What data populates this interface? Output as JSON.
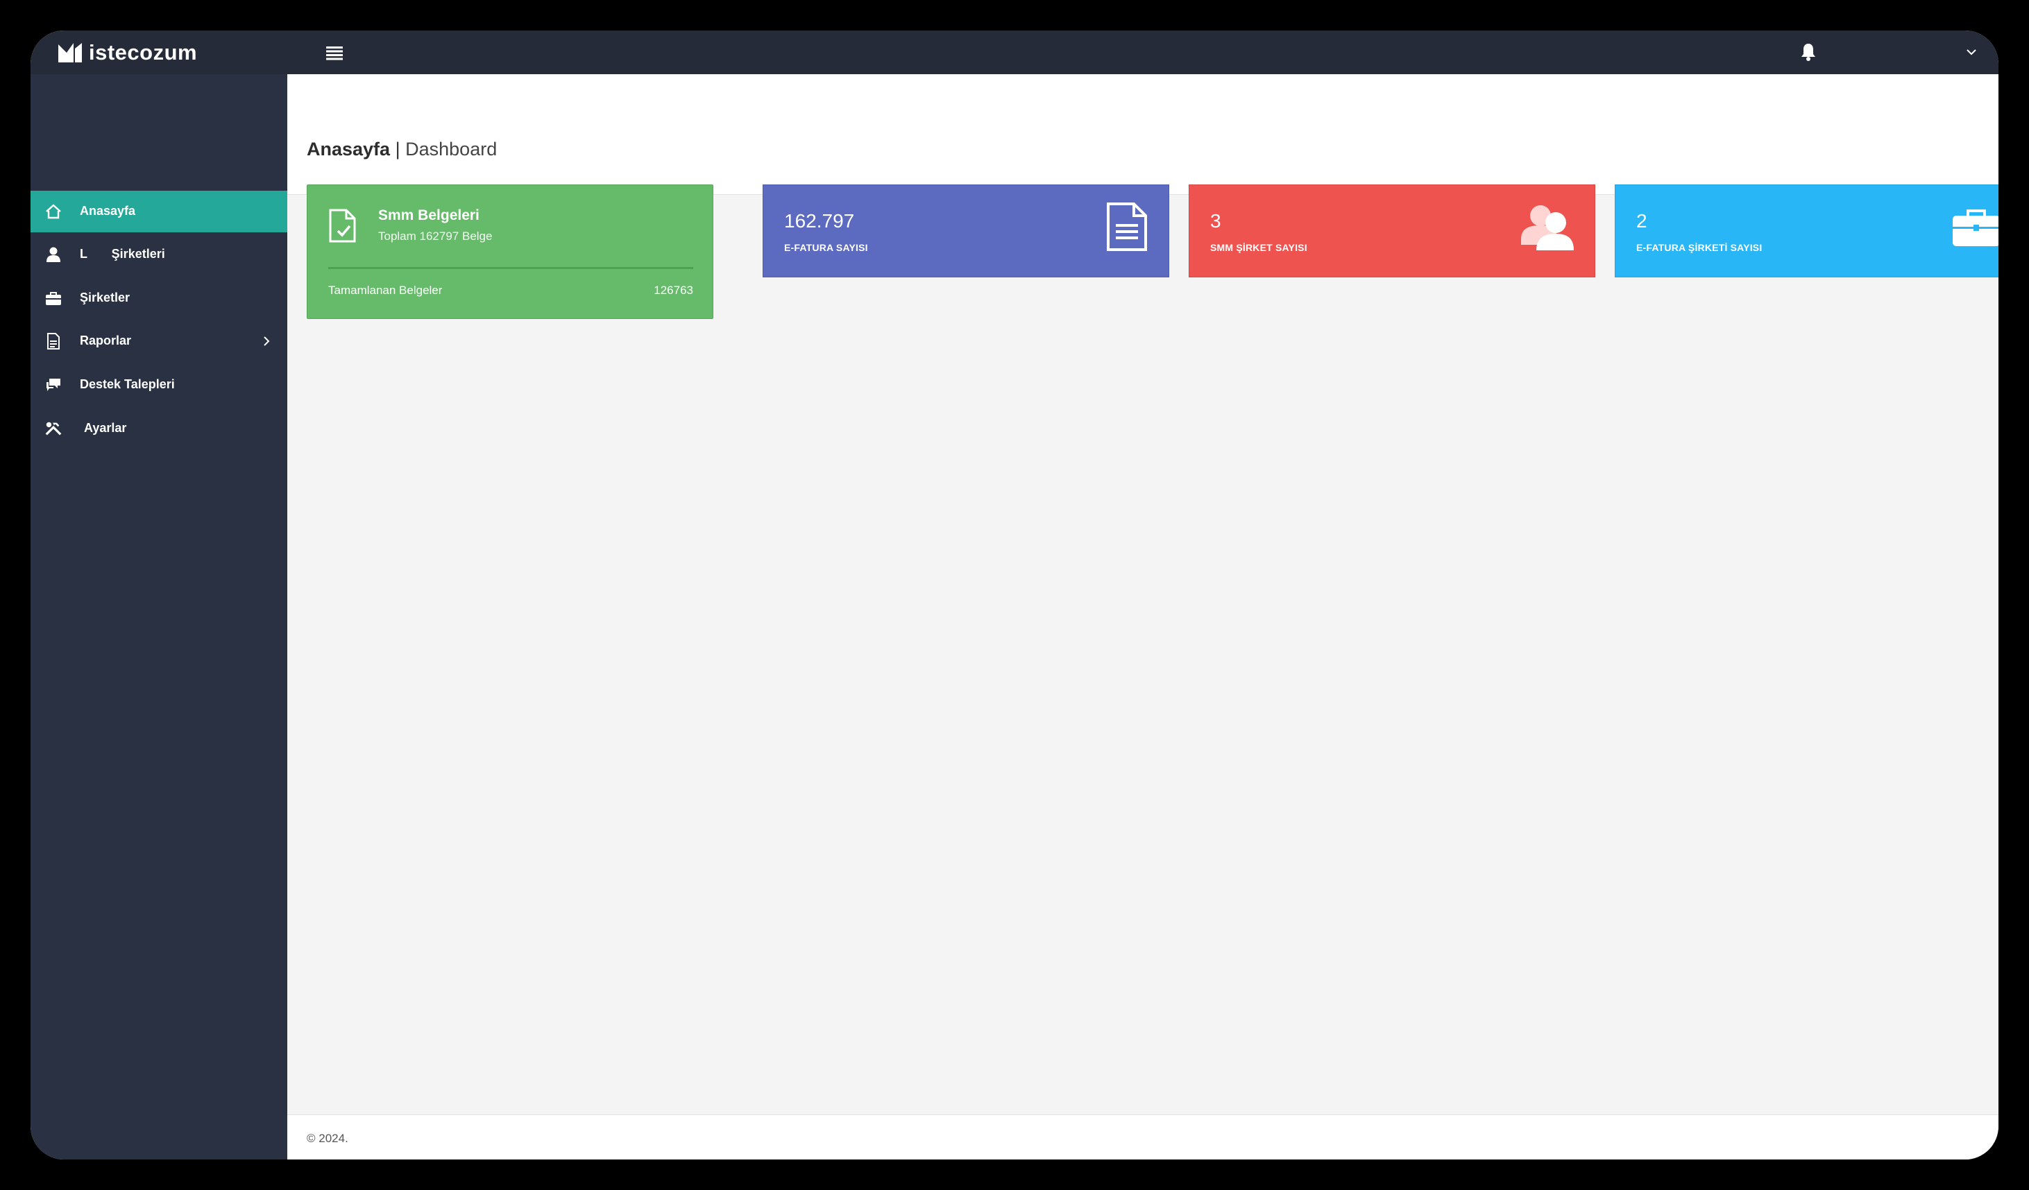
{
  "app": {
    "brand_name": "istecozum",
    "accent_color": "#23a89a"
  },
  "header": {
    "menu_icon": "hamburger-icon",
    "notification_icon": "bell-icon",
    "user_menu_icon": "chevron-down-icon"
  },
  "sidebar": {
    "items": [
      {
        "label": "Anasayfa",
        "icon": "home-icon",
        "active": true
      },
      {
        "label": "L       Şirketleri",
        "icon": "user-icon",
        "active": false
      },
      {
        "label": "Şirketler",
        "icon": "briefcase-icon",
        "active": false
      },
      {
        "label": "Raporlar",
        "icon": "report-icon",
        "active": false,
        "has_submenu": true
      },
      {
        "label": "Destek Talepleri",
        "icon": "chat-icon",
        "active": false
      },
      {
        "label": "Ayarlar",
        "icon": "tools-icon",
        "active": false
      }
    ]
  },
  "page": {
    "title": "Anasayfa",
    "separator": "|",
    "subtitle": "Dashboard"
  },
  "cards": {
    "smm": {
      "title": "Smm Belgeleri",
      "subtitle": "Toplam 162797 Belge",
      "footer_label": "Tamamlanan Belgeler",
      "footer_value": "126763",
      "color": "#66bb6a"
    },
    "efatura_count": {
      "value": "162.797",
      "label": "E-FATURA SAYISI",
      "color": "#5c6bc0",
      "icon": "document-icon"
    },
    "smm_company_count": {
      "value": "3",
      "label": "SMM ŞİRKET SAYISI",
      "color": "#ef5350",
      "icon": "users-icon"
    },
    "efatura_company_count": {
      "value": "2",
      "label": "E-FATURA ŞİRKETİ SAYISI",
      "color": "#29b6f6",
      "icon": "briefcase-icon"
    }
  },
  "footer": {
    "copyright": "© 2024."
  }
}
